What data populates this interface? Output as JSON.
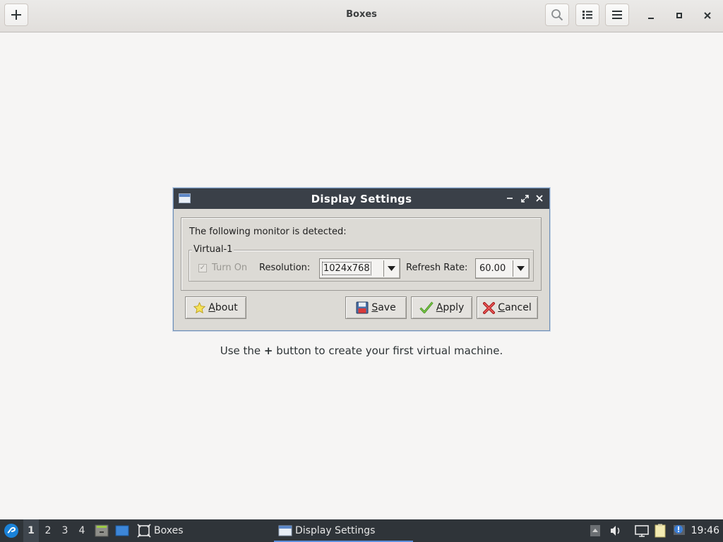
{
  "app": {
    "title": "Boxes"
  },
  "empty_state": {
    "prefix": "Use the",
    "plus": "+",
    "suffix": "button to create your first virtual machine."
  },
  "dialog": {
    "title": "Display Settings",
    "detected_text": "The following monitor is detected:",
    "monitor_name": "Virtual-1",
    "turn_on_label": "Turn On",
    "turn_on_checked": true,
    "resolution_label": "Resolution:",
    "resolution_value": "1024x768",
    "refresh_label": "Refresh Rate:",
    "refresh_value": "60.00",
    "buttons": {
      "about_pre": "",
      "about_ul": "A",
      "about_post": "bout",
      "save_pre": "",
      "save_ul": "S",
      "save_post": "ave",
      "apply_pre": "",
      "apply_ul": "A",
      "apply_post": "pply",
      "cancel_pre": "",
      "cancel_ul": "C",
      "cancel_post": "ancel"
    }
  },
  "taskbar": {
    "workspaces": [
      "1",
      "2",
      "3",
      "4"
    ],
    "active_workspace": "1",
    "tasks": {
      "boxes": "Boxes",
      "display_settings": "Display Settings"
    },
    "clock": "19:46"
  },
  "colors": {
    "accent": "#5d8fdc",
    "titlebar": "#3a4048",
    "taskbar": "#2f3439"
  }
}
